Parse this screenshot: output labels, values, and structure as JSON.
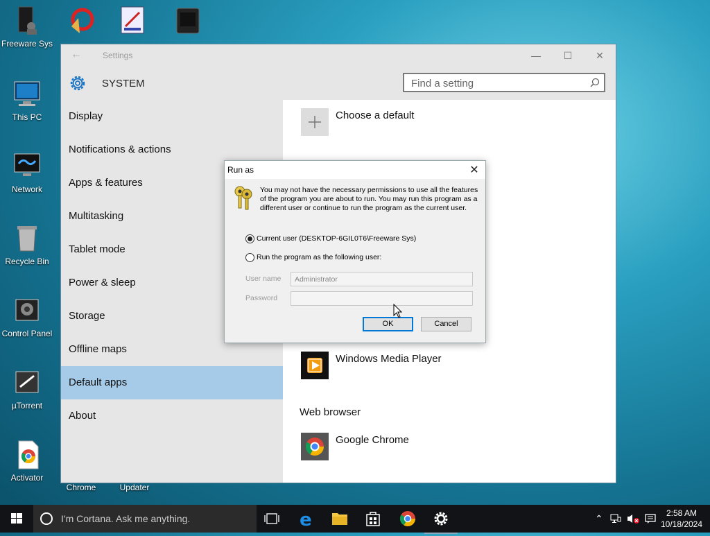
{
  "desktop": {
    "icons": [
      {
        "label": "Freeware Sys"
      },
      {
        "label": "This PC"
      },
      {
        "label": "Network"
      },
      {
        "label": "Recycle Bin"
      },
      {
        "label": "Control Panel"
      },
      {
        "label": "µTorrent"
      },
      {
        "label": "Activator"
      },
      {
        "label": "Chrome"
      },
      {
        "label": "Updater"
      }
    ]
  },
  "settings": {
    "title": "Settings",
    "section": "SYSTEM",
    "search_placeholder": "Find a setting",
    "nav": [
      {
        "label": "Display"
      },
      {
        "label": "Notifications & actions"
      },
      {
        "label": "Apps & features"
      },
      {
        "label": "Multitasking"
      },
      {
        "label": "Tablet mode"
      },
      {
        "label": "Power & sleep"
      },
      {
        "label": "Storage"
      },
      {
        "label": "Offline maps"
      },
      {
        "label": "Default apps",
        "selected": true
      },
      {
        "label": "About"
      }
    ],
    "content": {
      "choose_default": "Choose a default",
      "video_player_app": "Windows Media Player",
      "web_browser_heading": "Web browser",
      "web_browser_app": "Google Chrome"
    }
  },
  "runas_dialog": {
    "title": "Run as",
    "message": "You may not have the necessary permissions to use all the features of the program you are about to run. You may run this program as a different user or continue to run the program as the current user.",
    "option_current": "Current user (DESKTOP-6GIL0T6\\Freeware Sys)",
    "option_other": "Run the program as the following user:",
    "selected_option": "current",
    "username_label": "User name",
    "username_value": "Administrator",
    "password_label": "Password",
    "password_value": "",
    "ok_label": "OK",
    "cancel_label": "Cancel"
  },
  "taskbar": {
    "cortana_placeholder": "I'm Cortana. Ask me anything.",
    "time": "2:58 AM",
    "date": "10/18/2024"
  },
  "colors": {
    "selected_nav": "#a6cbe8",
    "accent": "#0078d7",
    "taskbar": "#111316"
  }
}
